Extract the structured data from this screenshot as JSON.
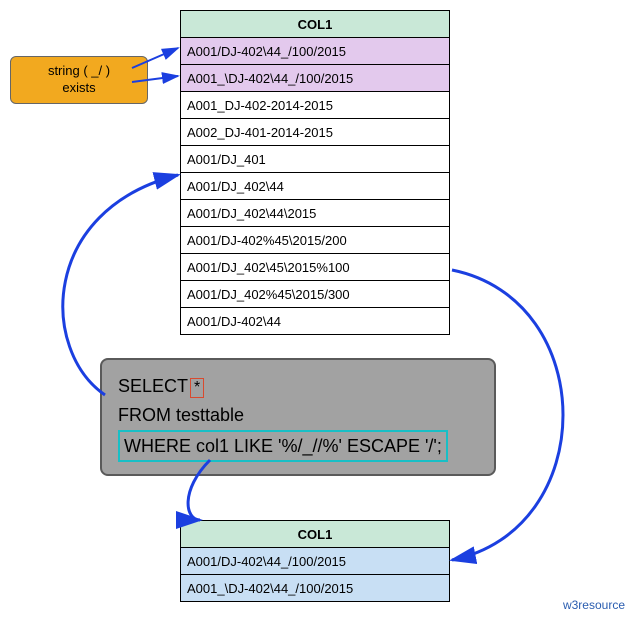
{
  "label": {
    "line1": "string ( _/ )",
    "line2": "exists"
  },
  "source_table": {
    "header": "COL1",
    "rows": [
      "A001/DJ-402\\44_/100/2015",
      "A001_\\DJ-402\\44_/100/2015",
      "A001_DJ-402-2014-2015",
      "A002_DJ-401-2014-2015",
      "A001/DJ_401",
      "A001/DJ_402\\44",
      "A001/DJ_402\\44\\2015",
      "A001/DJ-402%45\\2015/200",
      "A001/DJ_402\\45\\2015%100",
      "A001/DJ_402%45\\2015/300",
      "A001/DJ-402\\44"
    ]
  },
  "sql": {
    "select_kw": "SELECT",
    "star": "*",
    "from": "FROM testtable",
    "where": "WHERE col1   LIKE '%/_//%' ESCAPE '/';"
  },
  "result_table": {
    "header": "COL1",
    "rows": [
      "A001/DJ-402\\44_/100/2015",
      "A001_\\DJ-402\\44_/100/2015"
    ]
  },
  "credit": "w3resource",
  "highlight_indices": [
    0,
    1
  ]
}
